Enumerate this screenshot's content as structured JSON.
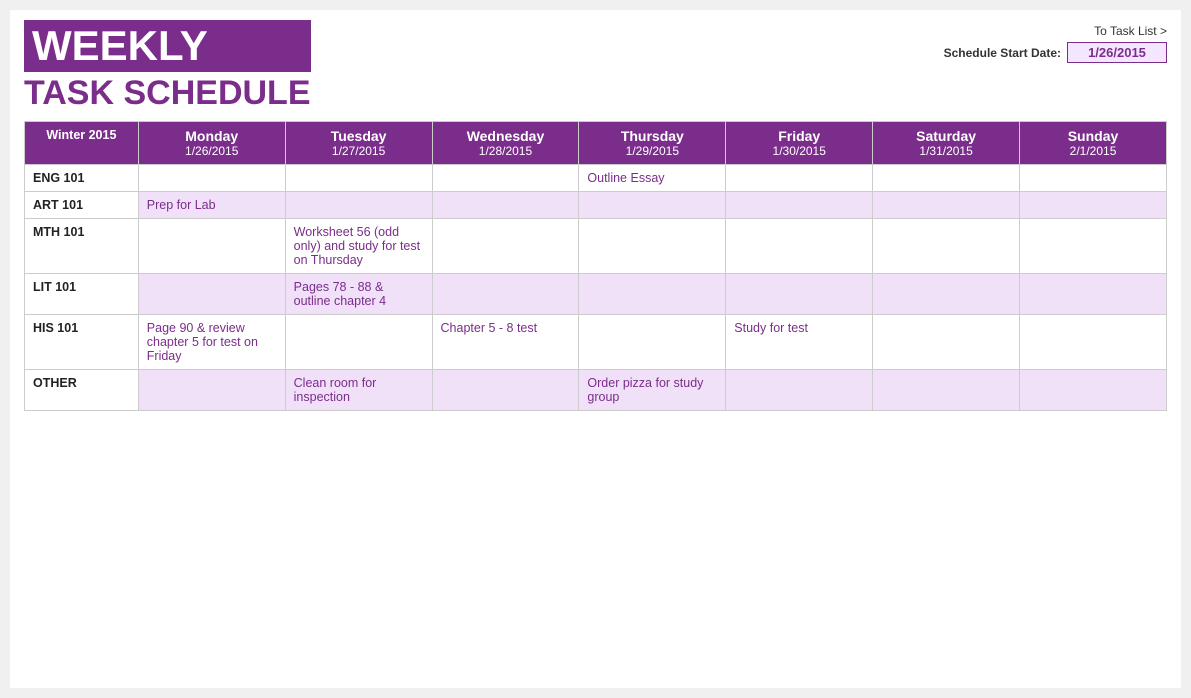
{
  "header": {
    "weekly": "WEEKLY",
    "task_schedule": "TASK SCHEDULE",
    "to_task_list": "To Task List >",
    "start_date_label": "Schedule Start Date:",
    "start_date_value": "1/26/2015"
  },
  "table": {
    "season": "Winter 2015",
    "columns": [
      {
        "day": "Monday",
        "date": "1/26/2015"
      },
      {
        "day": "Tuesday",
        "date": "1/27/2015"
      },
      {
        "day": "Wednesday",
        "date": "1/28/2015"
      },
      {
        "day": "Thursday",
        "date": "1/29/2015"
      },
      {
        "day": "Friday",
        "date": "1/30/2015"
      },
      {
        "day": "Saturday",
        "date": "1/31/2015"
      },
      {
        "day": "Sunday",
        "date": "2/1/2015"
      }
    ],
    "rows": [
      {
        "label": "ENG 101",
        "style": "white",
        "cells": [
          "",
          "",
          "",
          "Outline Essay",
          "",
          "",
          ""
        ]
      },
      {
        "label": "ART 101",
        "style": "purple",
        "cells": [
          "Prep for Lab",
          "",
          "",
          "",
          "",
          "",
          ""
        ]
      },
      {
        "label": "MTH 101",
        "style": "white",
        "cells": [
          "",
          "Worksheet 56 (odd only) and study for test on Thursday",
          "",
          "",
          "",
          "",
          ""
        ]
      },
      {
        "label": "LIT 101",
        "style": "purple",
        "cells": [
          "",
          "Pages 78 - 88 & outline chapter 4",
          "",
          "",
          "",
          "",
          ""
        ]
      },
      {
        "label": "HIS 101",
        "style": "white",
        "cells": [
          "Page 90 & review chapter 5 for test on Friday",
          "",
          "Chapter 5 - 8 test",
          "",
          "Study for test",
          "",
          ""
        ]
      },
      {
        "label": "OTHER",
        "style": "purple",
        "cells": [
          "",
          "Clean room for inspection",
          "",
          "Order pizza for study group",
          "",
          "",
          ""
        ]
      }
    ]
  }
}
